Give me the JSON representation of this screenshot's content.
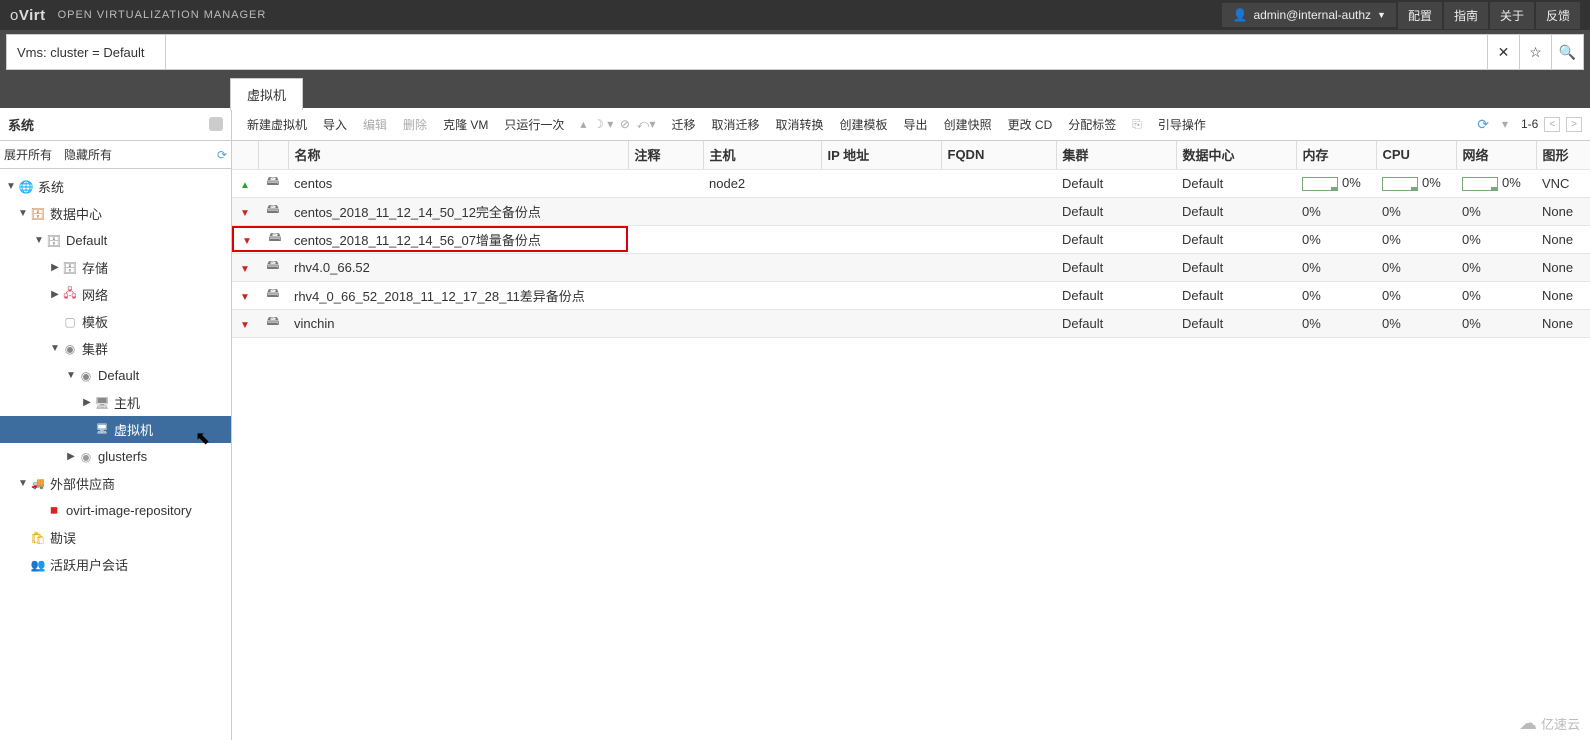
{
  "header": {
    "logo": "oVirt",
    "subtitle": "OPEN VIRTUALIZATION MANAGER",
    "user": "admin@internal-authz",
    "nav": [
      "配置",
      "指南",
      "关于",
      "反馈"
    ]
  },
  "search": {
    "scope": "Vms: cluster = Default",
    "query": ""
  },
  "tab": "虚拟机",
  "sidebar": {
    "title": "系统",
    "expand_all": "展开所有",
    "collapse_all": "隐藏所有",
    "items": {
      "root": "系统",
      "datacenter": "数据中心",
      "default_dc": "Default",
      "storage": "存储",
      "network": "网络",
      "template": "模板",
      "cluster": "集群",
      "default_cluster": "Default",
      "host": "主机",
      "vm": "虚拟机",
      "glusterfs": "glusterfs",
      "external": "外部供应商",
      "image_repo": "ovirt-image-repository",
      "errors": "勘误",
      "sessions": "活跃用户会话"
    }
  },
  "toolbar": {
    "new_vm": "新建虚拟机",
    "import": "导入",
    "edit": "编辑",
    "delete": "删除",
    "clone": "克隆 VM",
    "run_once": "只运行一次",
    "migrate": "迁移",
    "cancel_migrate": "取消迁移",
    "cancel_convert": "取消转换",
    "create_template": "创建模板",
    "export": "导出",
    "create_snapshot": "创建快照",
    "change_cd": "更改 CD",
    "assign_tags": "分配标签",
    "guide": "引导操作",
    "range": "1-6"
  },
  "columns": {
    "name": "名称",
    "comment": "注释",
    "host": "主机",
    "ip": "IP 地址",
    "fqdn": "FQDN",
    "cluster": "集群",
    "datacenter": "数据中心",
    "memory": "内存",
    "cpu": "CPU",
    "network": "网络",
    "graphics": "图形"
  },
  "vms": [
    {
      "status": "up",
      "name": "centos",
      "host": "node2",
      "cluster": "Default",
      "dc": "Default",
      "mem": "0%",
      "cpu": "0%",
      "net": "0%",
      "graphics": "VNC",
      "spark": true,
      "highlight": false
    },
    {
      "status": "down",
      "name": "centos_2018_11_12_14_50_12完全备份点",
      "host": "",
      "cluster": "Default",
      "dc": "Default",
      "mem": "0%",
      "cpu": "0%",
      "net": "0%",
      "graphics": "None",
      "spark": false,
      "highlight": false
    },
    {
      "status": "down",
      "name": "centos_2018_11_12_14_56_07增量备份点",
      "host": "",
      "cluster": "Default",
      "dc": "Default",
      "mem": "0%",
      "cpu": "0%",
      "net": "0%",
      "graphics": "None",
      "spark": false,
      "highlight": true
    },
    {
      "status": "down",
      "name": "rhv4.0_66.52",
      "host": "",
      "cluster": "Default",
      "dc": "Default",
      "mem": "0%",
      "cpu": "0%",
      "net": "0%",
      "graphics": "None",
      "spark": false,
      "highlight": false
    },
    {
      "status": "down",
      "name": "rhv4_0_66_52_2018_11_12_17_28_11差异备份点",
      "host": "",
      "cluster": "Default",
      "dc": "Default",
      "mem": "0%",
      "cpu": "0%",
      "net": "0%",
      "graphics": "None",
      "spark": false,
      "highlight": false
    },
    {
      "status": "down",
      "name": "vinchin",
      "host": "",
      "cluster": "Default",
      "dc": "Default",
      "mem": "0%",
      "cpu": "0%",
      "net": "0%",
      "graphics": "None",
      "spark": false,
      "highlight": false
    }
  ],
  "watermark": "亿速云"
}
